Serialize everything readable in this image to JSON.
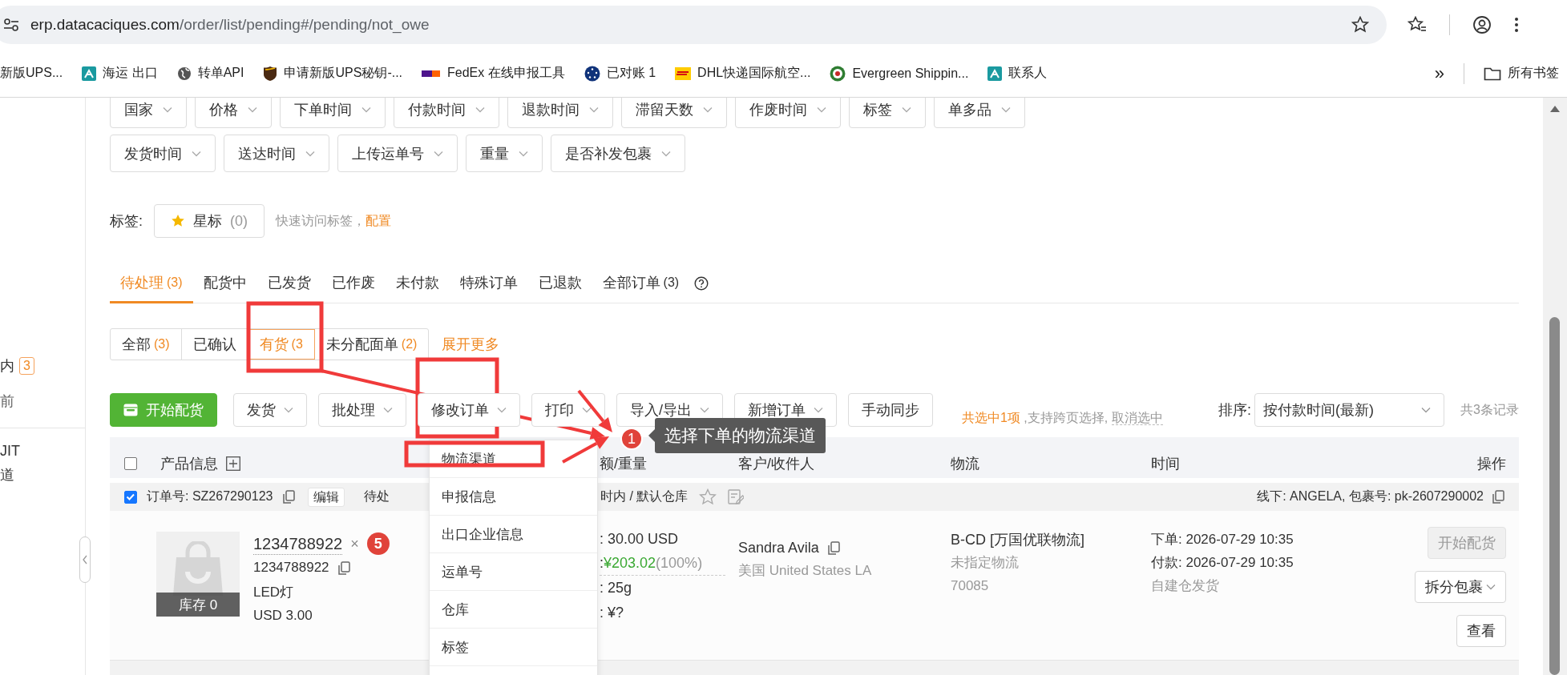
{
  "browser": {
    "url_host": "erp.datacaciques.com",
    "url_path": "/order/list/pending#/pending/not_owe",
    "bookmarks": [
      {
        "label": "新版UPS..."
      },
      {
        "label": "海运 出口"
      },
      {
        "label": "转单API"
      },
      {
        "label": "申请新版UPS秘钥-..."
      },
      {
        "label": "FedEx 在线申报工具"
      },
      {
        "label": "已对账 1"
      },
      {
        "label": "DHL快递国际航空..."
      },
      {
        "label": "Evergreen Shippin..."
      },
      {
        "label": "联系人"
      }
    ],
    "more": "»",
    "all_bookmarks": "所有书签"
  },
  "sidebar": {
    "items": [
      {
        "label": "内",
        "badge": "3"
      },
      {
        "label": "前"
      },
      {
        "label": "JIT"
      },
      {
        "label": "道"
      }
    ]
  },
  "filters": {
    "rows": [
      [
        "国家",
        "价格",
        "下单时间",
        "付款时间",
        "退款时间",
        "滞留天数",
        "作废时间",
        "标签",
        "单多品"
      ],
      [
        "发货时间",
        "送达时间",
        "上传运单号",
        "重量",
        "是否补发包裹"
      ]
    ]
  },
  "tags": {
    "label": "标签:",
    "star": "星标",
    "star_count": "(0)",
    "hint": "快速访问标签，",
    "link": "配置"
  },
  "tabs": [
    {
      "label": "待处理",
      "count": "(3)",
      "selected": true
    },
    {
      "label": "配货中",
      "selected": false
    },
    {
      "label": "已发货",
      "selected": false
    },
    {
      "label": "已作废",
      "selected": false
    },
    {
      "label": "未付款",
      "selected": false
    },
    {
      "label": "特殊订单",
      "selected": false
    },
    {
      "label": "已退款",
      "selected": false
    },
    {
      "label": "全部订单",
      "count": "(3)",
      "selected": false
    }
  ],
  "subtabs": [
    {
      "label": "全部",
      "count": "(3)",
      "selected": false
    },
    {
      "label": "已确认",
      "selected": false
    },
    {
      "label": "有货",
      "count": "(3",
      "selected": true
    },
    {
      "label": "未分配面单",
      "count": "(2)",
      "selected": false
    }
  ],
  "expand": "展开更多",
  "toolbar": {
    "buttons": [
      {
        "label": "开始配货",
        "kind": "primary"
      },
      {
        "label": "发货",
        "kind": "dropdown"
      },
      {
        "label": "批处理",
        "kind": "dropdown"
      },
      {
        "label": "修改订单",
        "kind": "dropdown"
      },
      {
        "label": "打印",
        "kind": "dropdown"
      },
      {
        "label": "导入/导出",
        "kind": "dropdown"
      },
      {
        "label": "新增订单",
        "kind": "dropdown"
      },
      {
        "label": "手动同步",
        "kind": "plain"
      }
    ],
    "selection": "共选中1项",
    "selection_hint": ",支持跨页选择,",
    "clear": "取消选中",
    "sort_label": "排序:",
    "sort_value": "按付款时间(最新)",
    "total": "共3条记录"
  },
  "table": {
    "all_checked": false,
    "columns": [
      "产品信息",
      "额/重量",
      "客户/收件人",
      "物流",
      "时间",
      "操作"
    ]
  },
  "order": {
    "checked": true,
    "order_no": "订单号: SZ267290123",
    "edit": "编辑",
    "status": "待处",
    "warehouse": "时内 / 默认仓库",
    "starred": false,
    "package": "线下: ANGELA, 包裹号: pk-2607290002",
    "product": {
      "stock": "库存 0",
      "title": "1234788922",
      "remove": "×",
      "badge": "5",
      "sku": "1234788922",
      "name": "LED灯",
      "price": "USD 3.00"
    },
    "amounts": [
      {
        "kind": "plain",
        "label": ":",
        "value": "30.00 USD"
      },
      {
        "kind": "profit",
        "label": ":",
        "value": "¥203.02",
        "note": "(100%)"
      },
      {
        "kind": "plain",
        "label": ":",
        "value": "25g"
      },
      {
        "kind": "plain",
        "label": ":",
        "value": "¥?"
      }
    ],
    "customer": {
      "name": "Sandra Avila",
      "address": "美国 United States LA"
    },
    "logistics": {
      "channel": "B-CD [万国优联物流]",
      "carrier": "未指定物流",
      "code": "70085"
    },
    "time": {
      "ordered": "下单: 2026-07-29 10:35",
      "paid": "付款: 2026-07-29 10:35",
      "source": "自建仓发货"
    },
    "actions": [
      {
        "label": "开始配货",
        "kind": "plain",
        "disabled": true
      },
      {
        "label": "拆分包裹",
        "kind": "dropdown",
        "disabled": false
      },
      {
        "label": "查看",
        "kind": "plain",
        "disabled": false
      }
    ]
  },
  "menu": {
    "items": [
      "物流渠道",
      "申报信息",
      "出口企业信息",
      "运单号",
      "仓库",
      "标签"
    ]
  },
  "callout": {
    "step": "1",
    "text": "选择下单的物流渠道"
  }
}
